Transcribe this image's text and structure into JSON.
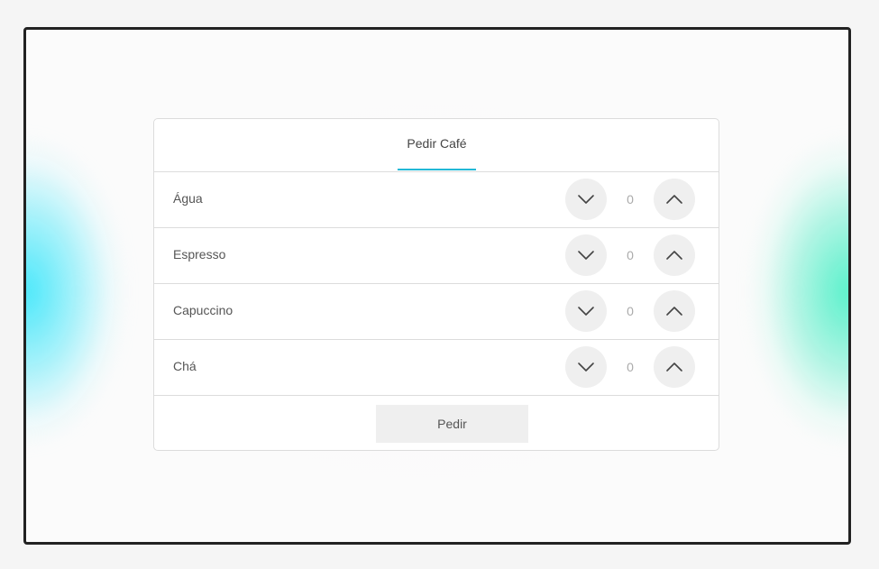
{
  "header": {
    "tab_label": "Pedir Café",
    "accent_color": "#22b8d6"
  },
  "items": [
    {
      "label": "Água",
      "quantity": "0"
    },
    {
      "label": "Espresso",
      "quantity": "0"
    },
    {
      "label": "Capuccino",
      "quantity": "0"
    },
    {
      "label": "Chá",
      "quantity": "0"
    }
  ],
  "stepper": {
    "decrement_icon": "chevron-down-icon",
    "increment_icon": "chevron-up-icon"
  },
  "footer": {
    "order_label": "Pedir"
  },
  "background": {
    "glow_left_color": "#40e6fa",
    "glow_right_color": "#50f0c8"
  }
}
